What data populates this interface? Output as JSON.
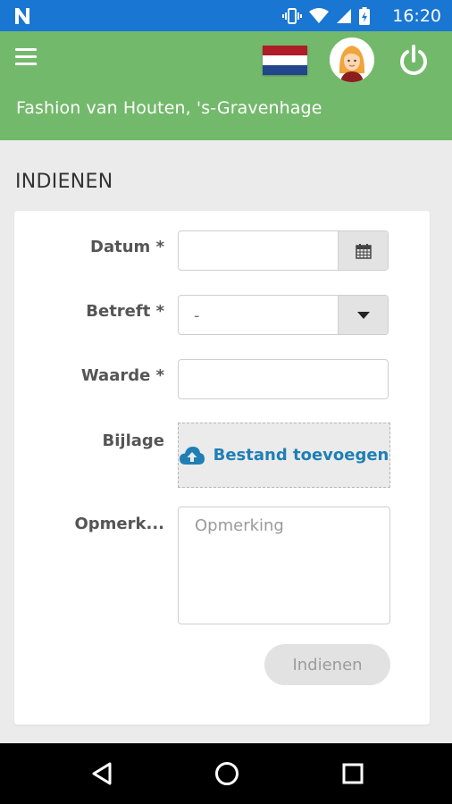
{
  "status_bar": {
    "time": "16:20",
    "icons": [
      "notification-n-icon",
      "vibrate-icon",
      "wifi-icon",
      "signal-icon",
      "battery-charging-icon"
    ]
  },
  "app_bar": {
    "menu_icon": "hamburger-menu-icon",
    "flag_colors": [
      "#ae1c28",
      "#ffffff",
      "#21468b"
    ],
    "avatar": "user-avatar",
    "power_icon": "power-icon",
    "location": "Fashion van Houten, 's-Gravenhage",
    "background_color": "#73b96b"
  },
  "section": {
    "title": "INDIENEN"
  },
  "form": {
    "date_label": "Datum *",
    "date_value": "",
    "date_icon": "calendar-icon",
    "subject_label": "Betreft *",
    "subject_selected": "-",
    "subject_icon": "caret-down-icon",
    "value_label": "Waarde *",
    "value_value": "",
    "attachment_label": "Bijlage",
    "attachment_button": "Bestand toevoegen",
    "attachment_icon": "cloud-upload-icon",
    "remark_label": "Opmerk...",
    "remark_placeholder": "Opmerking",
    "submit_label": "Indienen"
  },
  "nav_bar": {
    "buttons": [
      "back-icon",
      "home-icon",
      "recents-icon"
    ]
  }
}
